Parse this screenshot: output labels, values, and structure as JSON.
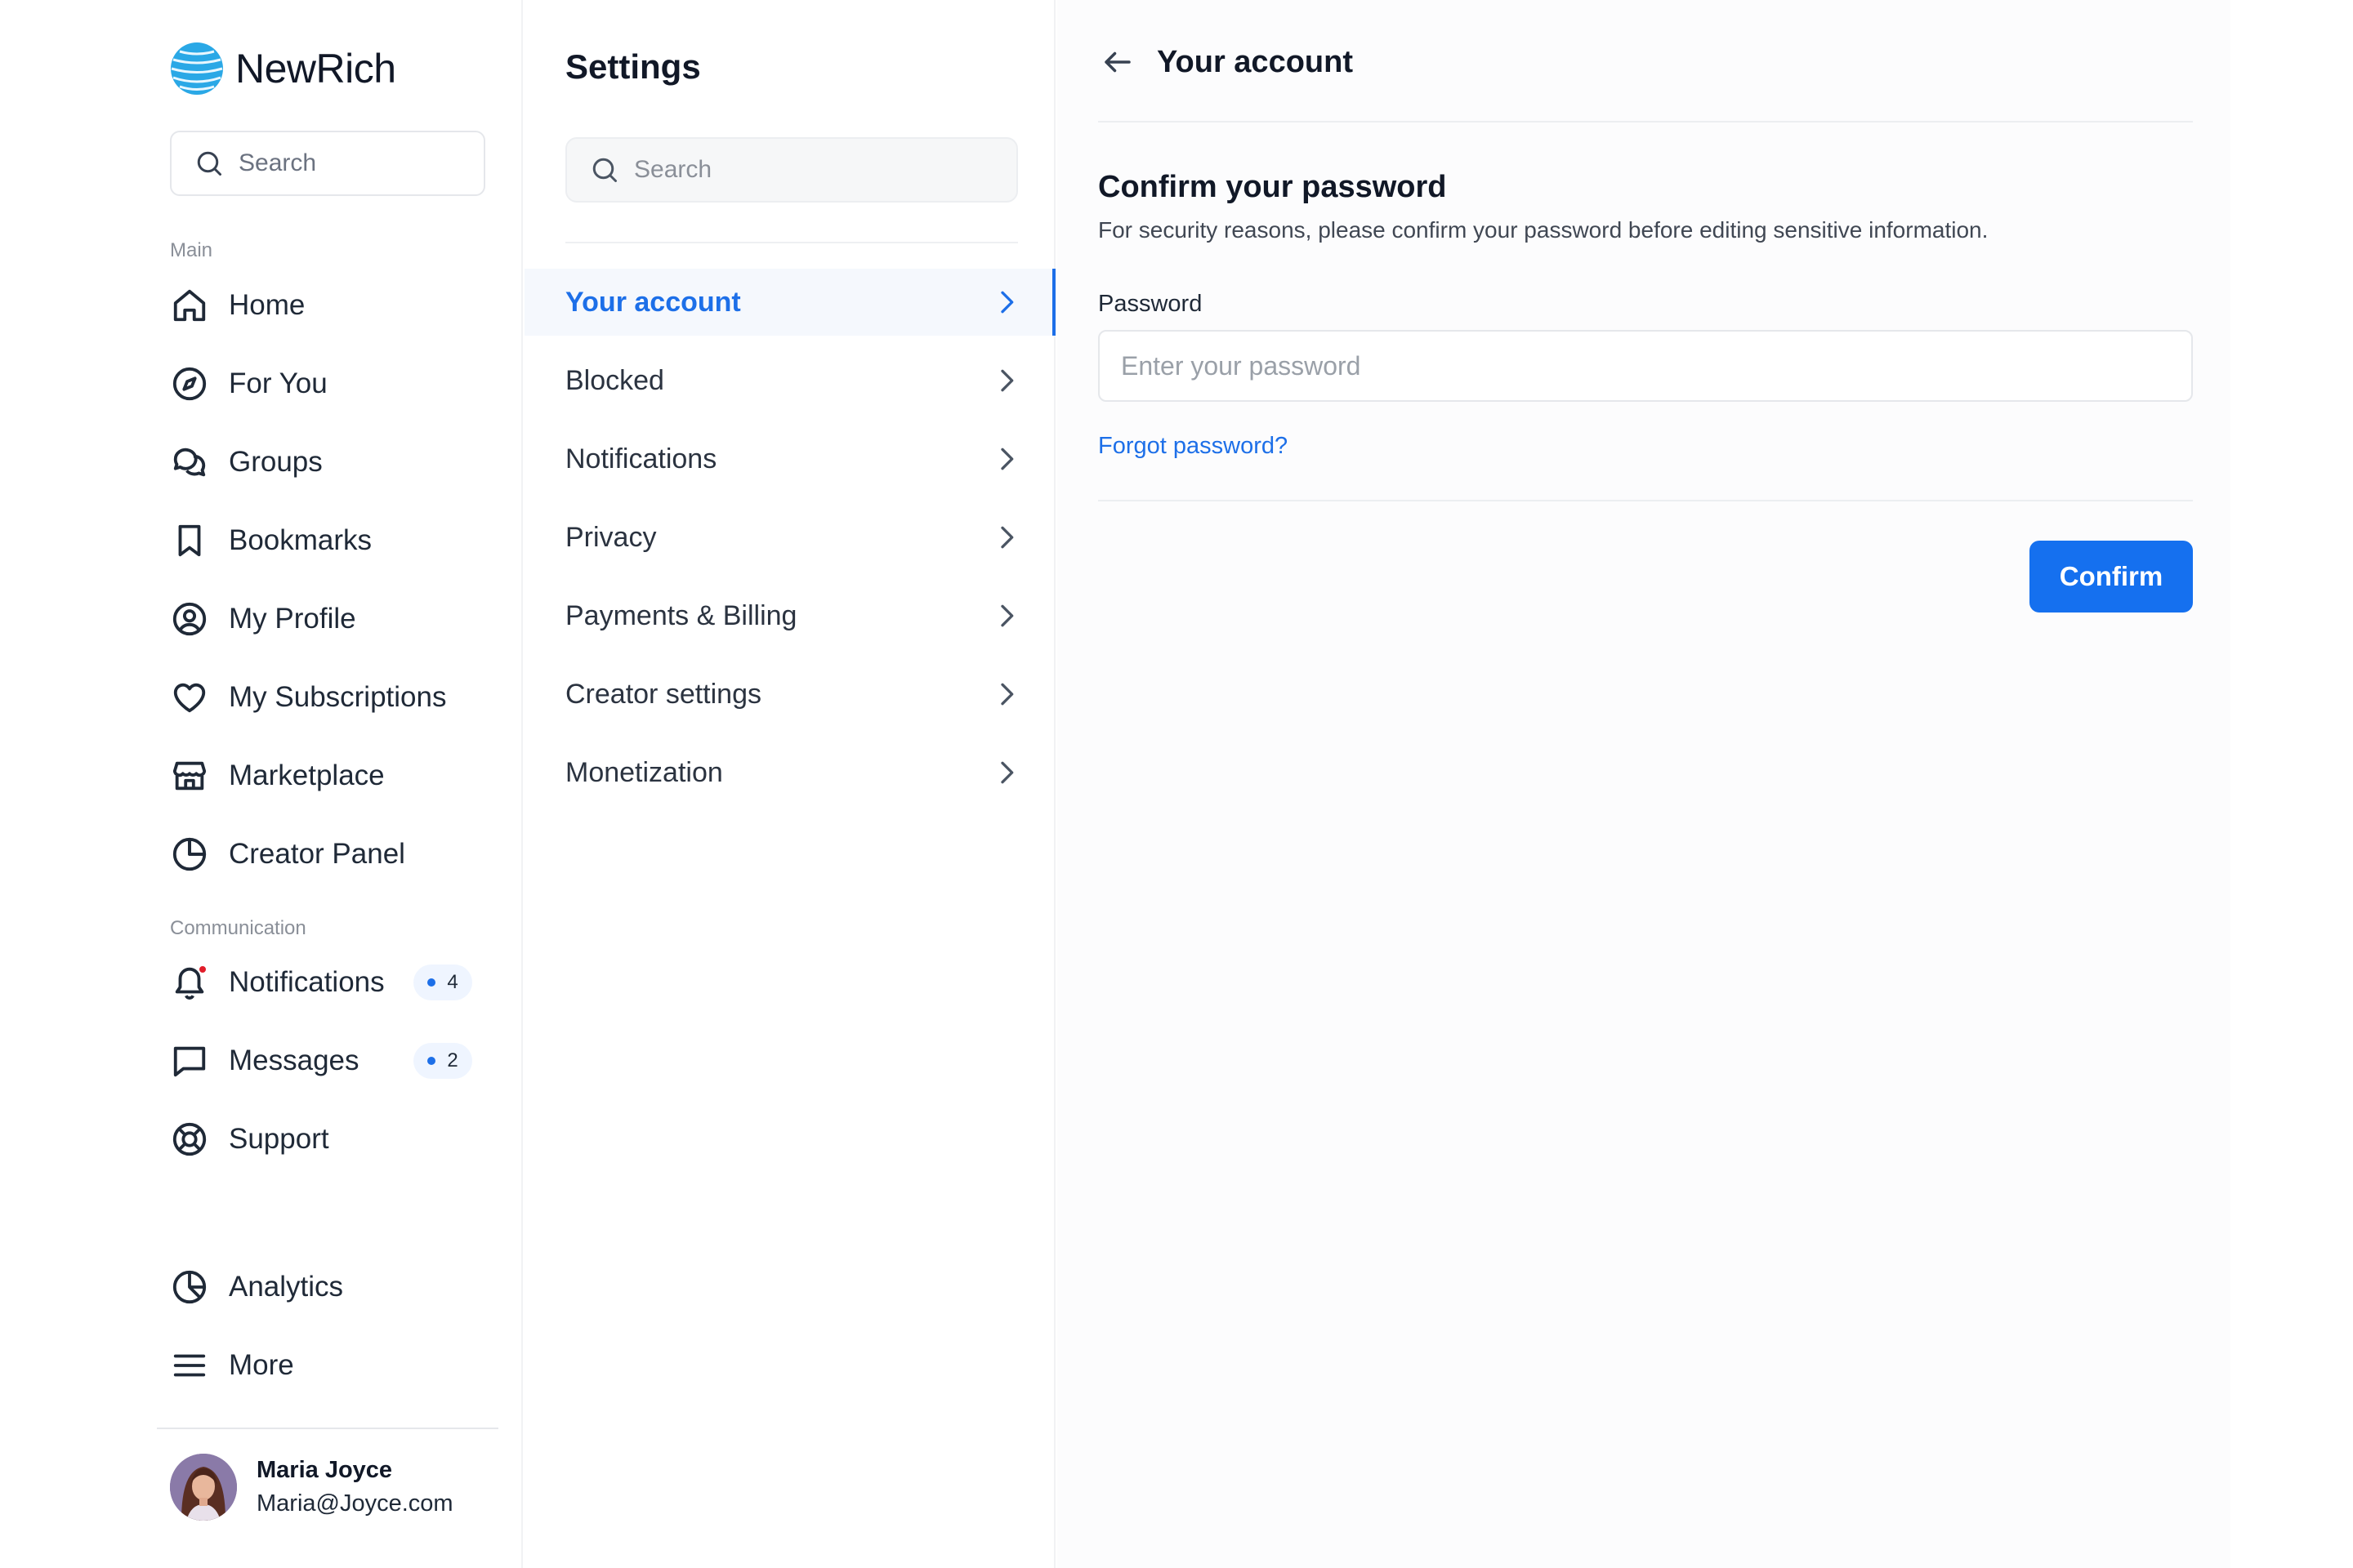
{
  "brand": {
    "name": "NewRich",
    "logo_icon": "globe-logo-icon",
    "logo_color": "#2aa8e6"
  },
  "nav": {
    "search_placeholder": "Search",
    "main_section_label": "Main",
    "main_items": [
      {
        "label": "Home",
        "icon": "home-icon"
      },
      {
        "label": "For You",
        "icon": "compass-icon"
      },
      {
        "label": "Groups",
        "icon": "chat-bubbles-icon"
      },
      {
        "label": "Bookmarks",
        "icon": "bookmark-icon"
      },
      {
        "label": "My Profile",
        "icon": "user-circle-icon"
      },
      {
        "label": "My Subscriptions",
        "icon": "heart-icon"
      },
      {
        "label": "Marketplace",
        "icon": "store-icon"
      },
      {
        "label": "Creator Panel",
        "icon": "pie-chart-icon"
      }
    ],
    "communication_section_label": "Communication",
    "communication_items": [
      {
        "label": "Notifications",
        "icon": "bell-icon",
        "badge": "4"
      },
      {
        "label": "Messages",
        "icon": "message-icon",
        "badge": "2"
      },
      {
        "label": "Support",
        "icon": "lifebuoy-icon"
      }
    ],
    "bottom_items": [
      {
        "label": "Analytics",
        "icon": "analytics-icon"
      },
      {
        "label": "More",
        "icon": "menu-icon"
      }
    ],
    "user": {
      "name": "Maria Joyce",
      "email": "Maria@Joyce.com"
    }
  },
  "settings": {
    "title": "Settings",
    "search_placeholder": "Search",
    "items": [
      {
        "label": "Your account",
        "active": true
      },
      {
        "label": "Blocked"
      },
      {
        "label": "Notifications"
      },
      {
        "label": "Privacy"
      },
      {
        "label": "Payments & Billing"
      },
      {
        "label": "Creator settings"
      },
      {
        "label": "Monetization"
      }
    ]
  },
  "main": {
    "title": "Your account",
    "heading": "Confirm your password",
    "description": "For security reasons, please confirm your password before editing sensitive information.",
    "password_label": "Password",
    "password_placeholder": "Enter your password",
    "password_value": "",
    "forgot_link": "Forgot password?",
    "confirm_button": "Confirm"
  },
  "colors": {
    "accent": "#1570ef",
    "notification_dot": "#e11d2a",
    "text": "#1f2937"
  }
}
